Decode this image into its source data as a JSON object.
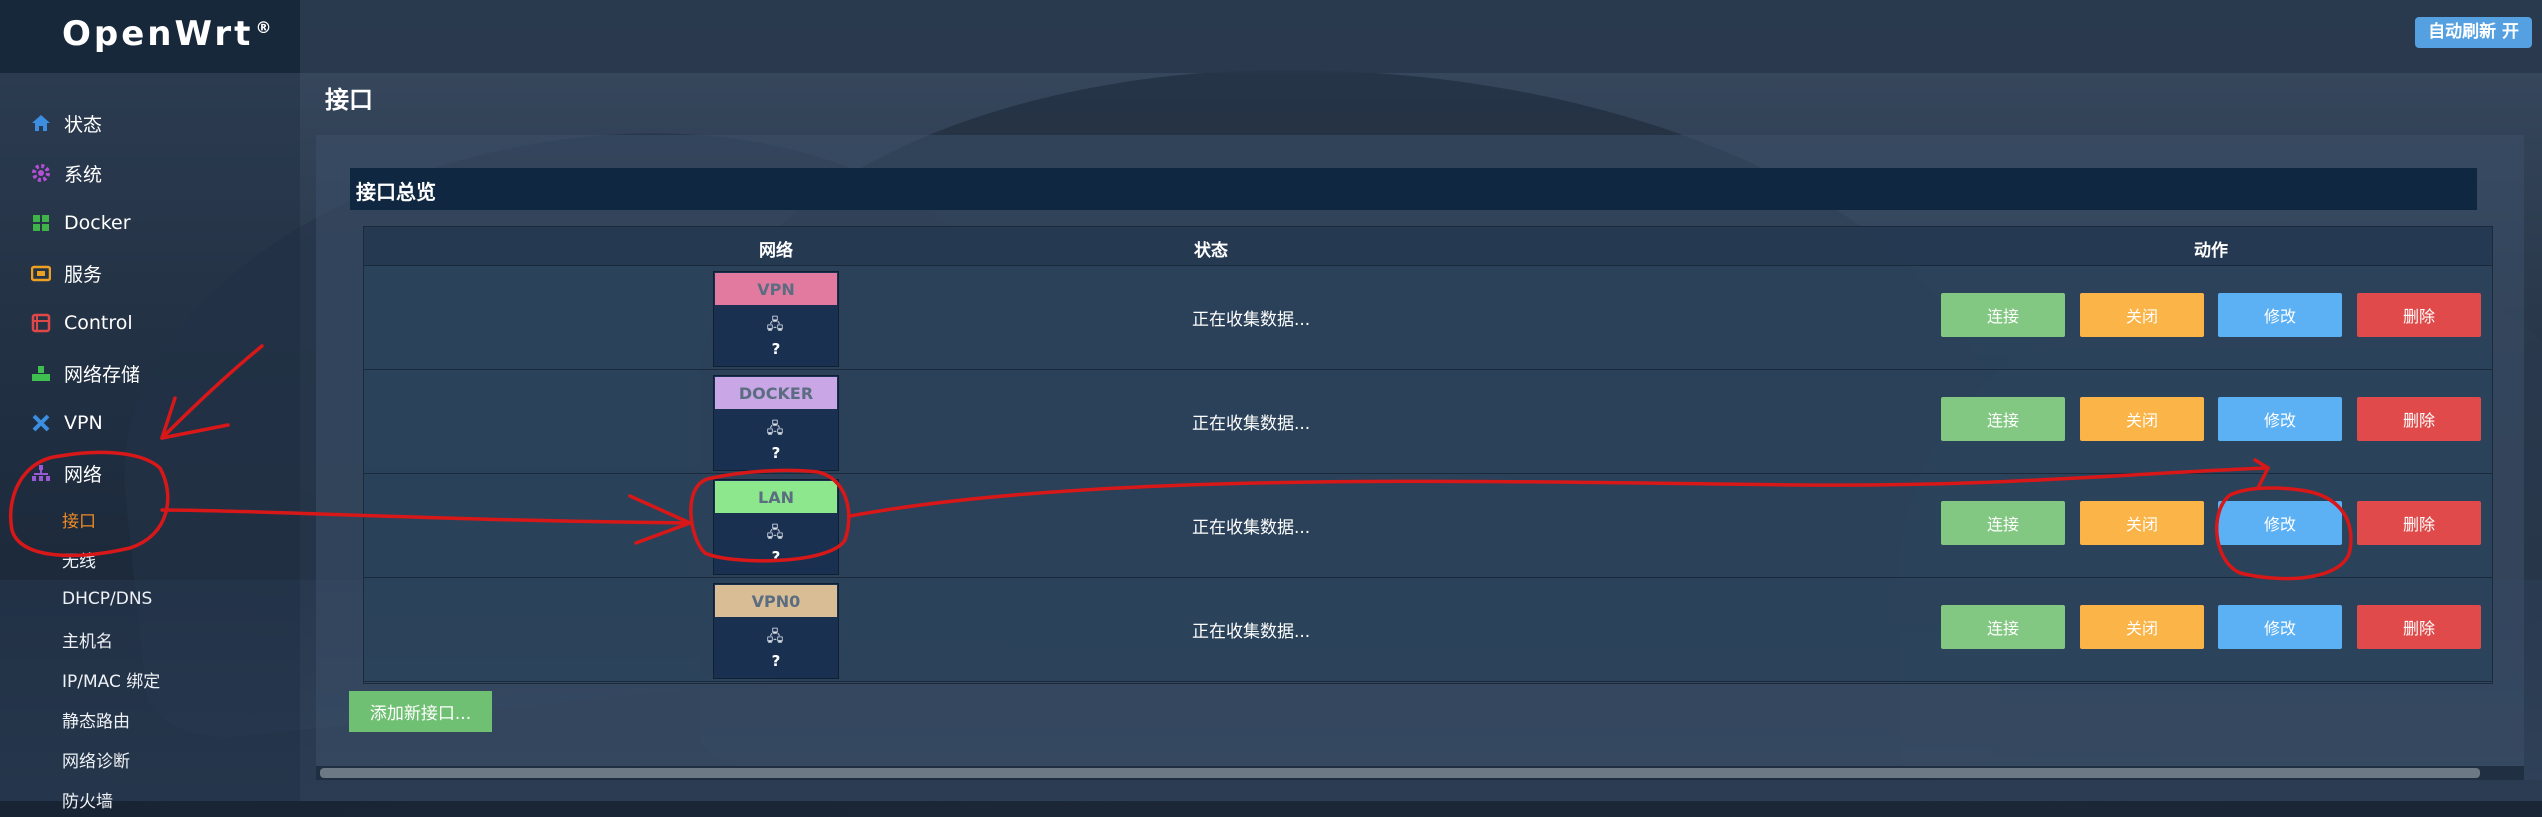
{
  "brand": {
    "name": "OpenWrt",
    "mark": "®"
  },
  "topbar": {
    "refresh_label": "自动刷新 开"
  },
  "sidebar": {
    "items": [
      {
        "label": "状态",
        "icon": "home-icon",
        "color": "#3b8ee0"
      },
      {
        "label": "系统",
        "icon": "gear-icon",
        "color": "#b44fd6"
      },
      {
        "label": "Docker",
        "icon": "grid-icon",
        "color": "#3fb24a"
      },
      {
        "label": "服务",
        "icon": "services-icon",
        "color": "#f0a020"
      },
      {
        "label": "Control",
        "icon": "control-icon",
        "color": "#e04848"
      },
      {
        "label": "网络存储",
        "icon": "storage-icon",
        "color": "#3fbf50"
      },
      {
        "label": "VPN",
        "icon": "vpn-icon",
        "color": "#3b8ee0"
      },
      {
        "label": "网络",
        "icon": "network-icon",
        "color": "#9a5ad6"
      }
    ],
    "sub_items": [
      {
        "label": "接口",
        "active": true
      },
      {
        "label": "无线",
        "active": false
      },
      {
        "label": "DHCP/DNS",
        "active": false
      },
      {
        "label": "主机名",
        "active": false
      },
      {
        "label": "IP/MAC 绑定",
        "active": false
      },
      {
        "label": "静态路由",
        "active": false
      },
      {
        "label": "网络诊断",
        "active": false
      },
      {
        "label": "防火墙",
        "active": false
      }
    ]
  },
  "main": {
    "title": "接口",
    "section_title": "接口总览",
    "table": {
      "headers": {
        "network": "网络",
        "status": "状态",
        "actions": "动作"
      },
      "rows": [
        {
          "name": "VPN",
          "badge_color": "#e27aa0",
          "device": "?",
          "status": "正在收集数据..."
        },
        {
          "name": "DOCKER",
          "badge_color": "#c9a6e6",
          "device": "?",
          "status": "正在收集数据..."
        },
        {
          "name": "LAN",
          "badge_color": "#8de88d",
          "device": "?",
          "status": "正在收集数据..."
        },
        {
          "name": "VPN0",
          "badge_color": "#d9bd94",
          "device": "?",
          "status": "正在收集数据..."
        }
      ],
      "actions": {
        "connect": "连接",
        "close": "关闭",
        "edit": "修改",
        "delete": "删除"
      }
    },
    "add_button": "添加新接口..."
  }
}
